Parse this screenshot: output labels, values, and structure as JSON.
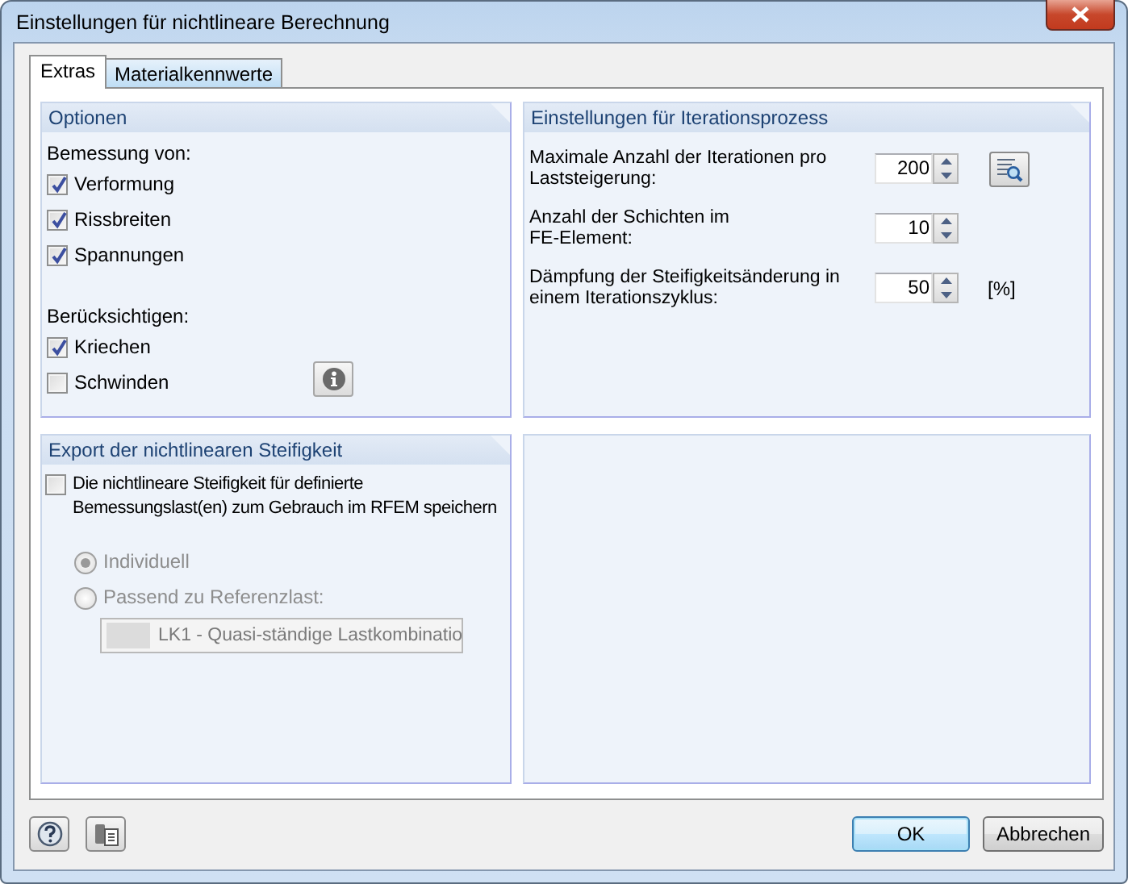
{
  "window": {
    "title": "Einstellungen für nichtlineare Berechnung"
  },
  "tabs": [
    {
      "label": "Extras",
      "selected": true
    },
    {
      "label": "Materialkennwerte",
      "selected": false
    }
  ],
  "options": {
    "title": "Optionen",
    "design_label": "Bemessung von:",
    "design_items": [
      {
        "label": "Verformung",
        "checked": true
      },
      {
        "label": "Rissbreiten",
        "checked": true
      },
      {
        "label": "Spannungen",
        "checked": true
      }
    ],
    "consider_label": "Berücksichtigen:",
    "consider_items": [
      {
        "label": "Kriechen",
        "checked": true
      },
      {
        "label": "Schwinden",
        "checked": false
      }
    ]
  },
  "iteration": {
    "title": "Einstellungen für Iterationsprozess",
    "rows": [
      {
        "kind": "details",
        "label": "Maximale Anzahl der Iterationen pro\nLaststeigerung:",
        "value": "200"
      },
      {
        "kind": "plain",
        "label": "Anzahl der Schichten im\nFE-Element:",
        "value": "10"
      },
      {
        "kind": "unit",
        "label": "Dämpfung der Steifigkeitsänderung in\neinem Iterationszyklus:",
        "value": "50",
        "unit": "[%]"
      }
    ]
  },
  "export": {
    "title": "Export der nichtlinearen Steifigkeit",
    "save": {
      "label": "Die nichtlineare Steifigkeit für definierte\nBemessungslast(en) zum Gebrauch im RFEM speichern",
      "checked": false
    },
    "modes": [
      {
        "label": "Individuell",
        "selected": true,
        "disabled": true
      },
      {
        "label": "Passend zu Referenzlast:",
        "selected": false,
        "disabled": true
      }
    ],
    "reference_load": {
      "value": "LK1 - Quasi-ständige Lastkombinatio",
      "disabled": true
    }
  },
  "buttons": [
    {
      "label": "OK",
      "kind": "default"
    },
    {
      "label": "Abbrechen",
      "kind": "normal"
    }
  ]
}
